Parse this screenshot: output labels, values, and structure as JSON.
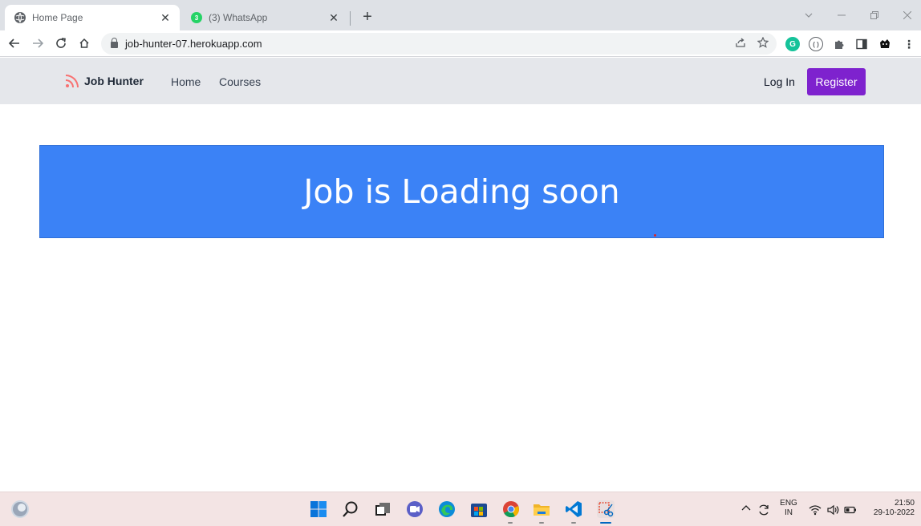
{
  "browser": {
    "tabs": [
      {
        "title": "Home Page",
        "close": "✕"
      },
      {
        "title": "(3) WhatsApp",
        "badge": "3",
        "close": "✕"
      }
    ],
    "new_tab": "+",
    "url": "job-hunter-07.herokuapp.com"
  },
  "site": {
    "brand": "Job Hunter",
    "nav_links": [
      "Home",
      "Courses"
    ],
    "login": "Log In",
    "register": "Register",
    "accent_color": "#7e22ce"
  },
  "hero": {
    "heading": "Job is Loading soon",
    "background_color": "#3b82f6"
  },
  "taskbar": {
    "language_line1": "ENG",
    "language_line2": "IN",
    "time": "21:50",
    "date": "29-10-2022"
  }
}
